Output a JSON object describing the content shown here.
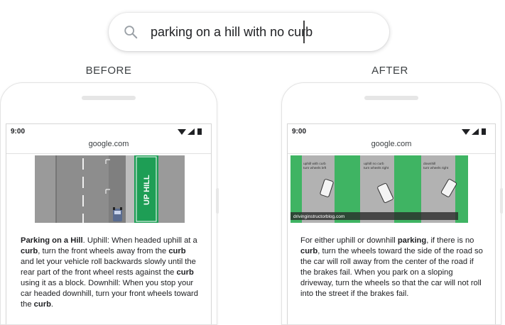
{
  "search": {
    "query": "parking on a hill with no curb",
    "icon": "search-icon"
  },
  "labels": {
    "before": "BEFORE",
    "after": "AFTER"
  },
  "before": {
    "status_time": "9:00",
    "url": "google.com",
    "image_text": "UP HILL",
    "snippet": [
      {
        "t": "Parking on a Hill",
        "b": true
      },
      {
        "t": ". Uphill: When headed uphill at a ",
        "b": false
      },
      {
        "t": "curb",
        "b": true
      },
      {
        "t": ", turn the front wheels away from the ",
        "b": false
      },
      {
        "t": "curb",
        "b": true
      },
      {
        "t": " and let your vehicle roll backwards slowly until the rear part of the front wheel rests against the ",
        "b": false
      },
      {
        "t": "curb",
        "b": true
      },
      {
        "t": " using it as a block. Downhill: When you stop your car headed downhill, turn your front wheels toward the ",
        "b": false
      },
      {
        "t": "curb",
        "b": true
      },
      {
        "t": ".",
        "b": false
      }
    ]
  },
  "after": {
    "status_time": "9:00",
    "url": "google.com",
    "panels": [
      {
        "caption": "uphill with curb\nturn wheels left"
      },
      {
        "caption": "uphill no curb\nturn wheels right"
      },
      {
        "caption": "downhill\nturn wheels right"
      }
    ],
    "watermark": "drivinginstructorblog.com",
    "snippet": [
      {
        "t": "For either uphill or downhill ",
        "b": false
      },
      {
        "t": "parking",
        "b": true
      },
      {
        "t": ", if there is no ",
        "b": false
      },
      {
        "t": "curb",
        "b": true
      },
      {
        "t": ", turn the wheels toward the side of the road so the car will roll away from the center of the road if the brakes fail. When you park on a sloping driveway, turn the wheels so that the car will not roll into the street if the brakes fail.",
        "b": false
      }
    ]
  },
  "colors": {
    "green": "#1e9e55",
    "road": "#8a8a8a",
    "light_green": "#4cbb6c"
  }
}
